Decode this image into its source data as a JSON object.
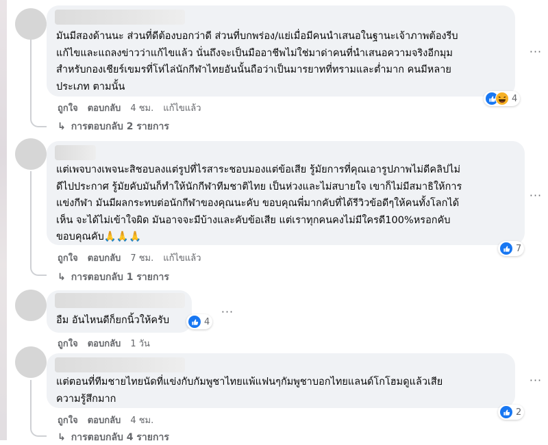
{
  "comments": [
    {
      "text": "มันมีสองด้านนะ ส่วนที่ดีต้องบอกว่าดี ส่วนที่บกพร่อง/แย่เมื่อมีคนนำเสนอในฐานะเจ้าภาพต้องรีบ\nแก้ไขและแถลงข่าวว่าแก้ไขแล้ว นั่นถึงจะเป็นมืออาชีพไม่ใช่มาด่าคนที่นำเสนอความจริงอีกมุม\nสำหรับกองเชียร์เขมรที่โห่ไล่นักกีฬาไทยอันนั้นถือว่าเป็นมารยาทที่ทรามและต่ำมาก คนมีหลาย\nประเภท ตามนั้น",
      "like_label": "ถูกใจ",
      "reply_label": "ตอบกลับ",
      "time": "4 ชม.",
      "edited": "แก้ไขแล้ว",
      "reaction_count": "4",
      "reaction_types": [
        "like-icon",
        "haha-icon"
      ],
      "replies": "การตอบกลับ 2 รายการ"
    },
    {
      "text": "แต่เพจบางเพจนะสิชอบลงแต่รูปที่ไรสาระชอบมองแต่ข้อเสีย รู้มัยการที่คุณเอารูปภาพไม่ดีคลิปไม่\nดีไปประกาศ รู้มัยคับมันก็ทำให้นักกีฬาทีมชาติไทย เป็นห่วงและไม่สบายใจ เขาก็ไม่มีสมาธิให้การ\nแข่งกีฬา มันมีผลกระทบต่อนักกีฬาของคุณนะคับ ขอบคุณพี่มากคับที่ได้รีวิวข้อดีๆให้คนทั้งโลกได้\nเห็น จะได้ไม่เข้าใจผิด มันอาจจะมีบ้างและคับข้อเสีย แต่เราทุกคนคงไม่มีใครดี100%หรอกคับ\nขอบคุณคับ🙏🙏🙏",
      "like_label": "ถูกใจ",
      "reply_label": "ตอบกลับ",
      "time": "7 ชม.",
      "edited": "แก้ไขแล้ว",
      "reaction_count": "7",
      "reaction_types": [
        "like-icon"
      ],
      "replies": "การตอบกลับ 1 รายการ"
    },
    {
      "text": "อืม อันไหนดีก็ยกนิ้วให้ครับ",
      "like_label": "ถูกใจ",
      "reply_label": "ตอบกลับ",
      "time": "1 วัน",
      "reaction_count": "4",
      "reaction_types": [
        "like-icon"
      ]
    },
    {
      "text": "แต่ตอนที่ทีมชายไทยนัดที่แข่งกับกัมพูชาไทยแพ้แฟนๆกัมพูชาบอกไทยแลนด์โกโฮมดูแล้วเสีย\nความรู้สึกมาก",
      "like_label": "ถูกใจ",
      "reply_label": "ตอบกลับ",
      "time": "4 ชม.",
      "reaction_count": "2",
      "reaction_types": [
        "like-icon"
      ],
      "replies": "การตอบกลับ 4 รายการ"
    }
  ],
  "more_options": "···",
  "colors": {
    "bubble": "#f0f2f5",
    "meta_text": "#65676b",
    "like_blue": "#1877f2",
    "haha_yellow": "#f7b125",
    "thread_line": "#ced0d4"
  }
}
